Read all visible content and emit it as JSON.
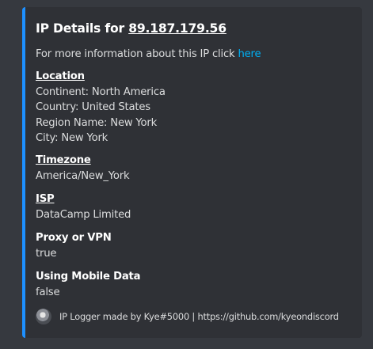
{
  "embed": {
    "title_prefix": "IP Details for ",
    "ip_address": "89.187.179.56",
    "description_text": "For more information about this IP click ",
    "description_link": "here",
    "accent_color": "#1e90ff",
    "location": {
      "heading": "Location",
      "continent": "Continent: North America",
      "country": "Country: United States",
      "region": "Region Name: New York",
      "city": "City: New York"
    },
    "timezone": {
      "heading": "Timezone",
      "value": "America/New_York"
    },
    "isp": {
      "heading": "ISP",
      "value": "DataCamp Limited"
    },
    "proxy": {
      "heading": "Proxy or VPN",
      "value": "true"
    },
    "mobile": {
      "heading": "Using Mobile Data",
      "value": "false"
    },
    "footer": {
      "avatar_icon": "avatar-icon",
      "text": "IP Logger made by Kye#5000 | https://github.com/kyeondiscord"
    }
  }
}
